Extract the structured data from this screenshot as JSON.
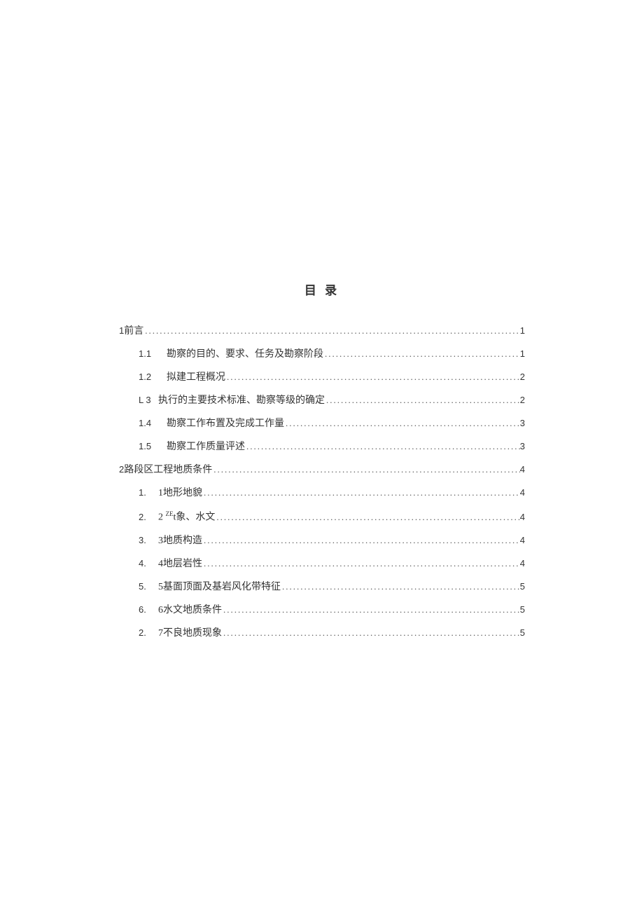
{
  "title": "目 录",
  "toc": {
    "s1": {
      "num": "1",
      "text": "前言",
      "page": "1",
      "items": {
        "i1": {
          "num": "1.1",
          "text": "勘察的目的、要求、任务及勘察阶段",
          "page": "1"
        },
        "i2": {
          "num": "1.2",
          "text": "拟建工程概况",
          "page": "2"
        },
        "i3": {
          "num": "L 3",
          "text": "执行的主要技术标准、勘察等级的确定",
          "page": "2"
        },
        "i4": {
          "num": "1.4",
          "text": "勘察工作布置及完成工作量",
          "page": "3"
        },
        "i5": {
          "num": "1.5",
          "text": "勘察工作质量评述",
          "page": "3"
        }
      }
    },
    "s2": {
      "num": "2",
      "text": "路段区工程地质条件",
      "page": "4",
      "items": {
        "i1": {
          "num": "1.",
          "prefix": "1",
          "text": "地形地貌",
          "page": "4"
        },
        "i2": {
          "num": "2.",
          "prefix": "2",
          "sup": "ZE",
          "suffix": "t象、水文",
          "page": "4"
        },
        "i3": {
          "num": "3.",
          "prefix": "3",
          "text": "地质构造",
          "page": "4"
        },
        "i4": {
          "num": "4.",
          "prefix": "4",
          "text": "地层岩性",
          "page": "4"
        },
        "i5": {
          "num": "5.",
          "prefix": "5",
          "text": "基面顶面及基岩风化带特征",
          "page": "5"
        },
        "i6": {
          "num": "6.",
          "prefix": "6",
          "text": "水文地质条件",
          "page": "5"
        },
        "i7": {
          "num": "2.",
          "prefix": "7",
          "text": "不良地质现象",
          "page": "5"
        }
      }
    }
  }
}
